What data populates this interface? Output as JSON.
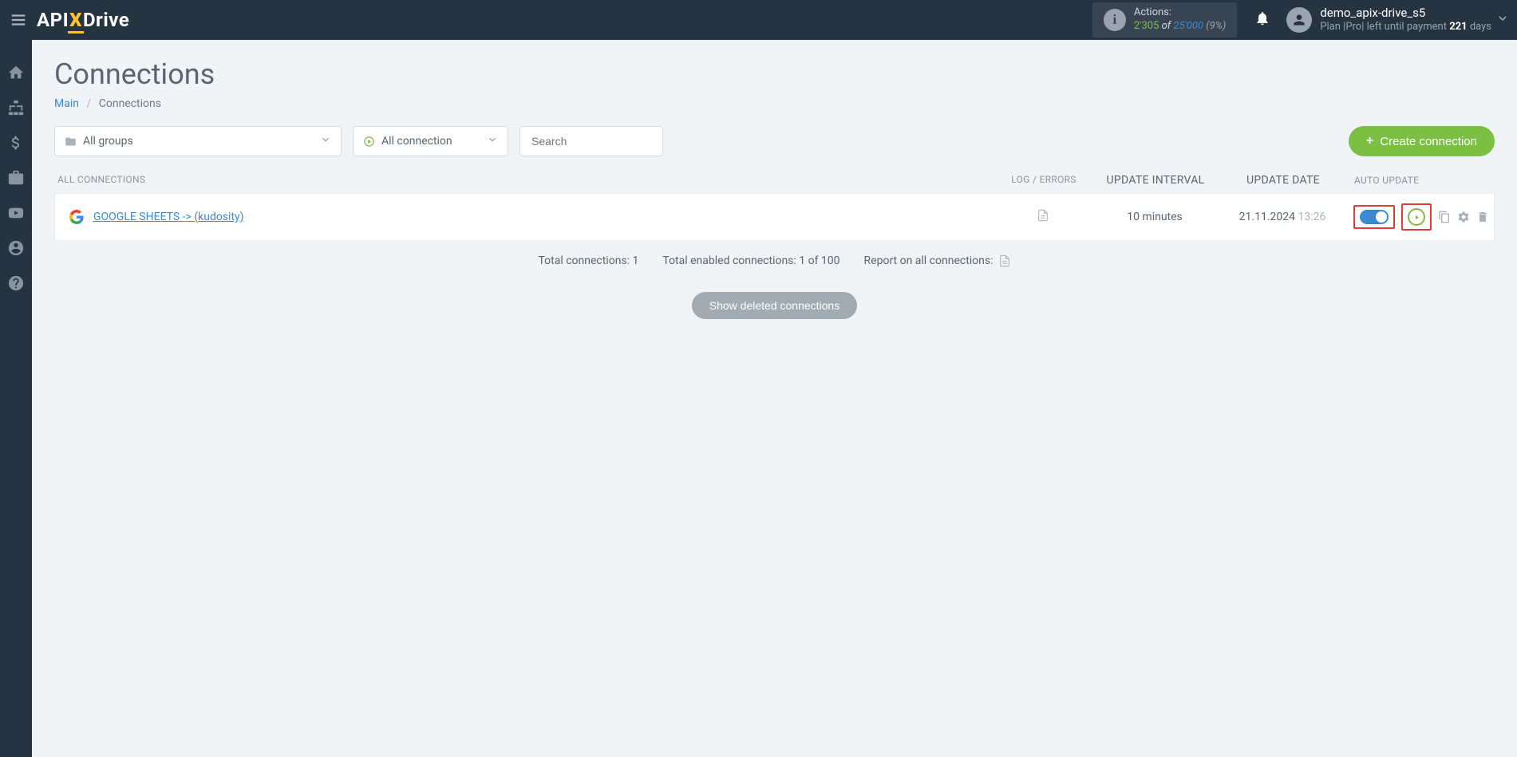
{
  "header": {
    "logo": {
      "api": "API",
      "x": "X",
      "drive": "Drive"
    },
    "actions": {
      "label": "Actions:",
      "used": "2'305",
      "of": "of",
      "total": "25'000",
      "pct": "(9%)"
    },
    "user": {
      "name": "demo_apix-drive_s5",
      "plan_prefix": "Plan |Pro| left until payment ",
      "days": "221",
      "days_suffix": " days"
    }
  },
  "sidebar": {
    "items": [
      "home",
      "sitemap",
      "dollar",
      "briefcase",
      "youtube",
      "user",
      "help"
    ]
  },
  "page": {
    "title": "Connections",
    "breadcrumb_main": "Main",
    "breadcrumb_current": "Connections"
  },
  "toolbar": {
    "groups_label": "All groups",
    "conn_label": "All connection",
    "search_placeholder": "Search",
    "create_label": "Create connection"
  },
  "table": {
    "headers": {
      "name": "ALL CONNECTIONS",
      "log": "LOG / ERRORS",
      "interval": "UPDATE INTERVAL",
      "date": "UPDATE DATE",
      "auto": "AUTO UPDATE"
    },
    "rows": [
      {
        "name": "GOOGLE SHEETS -> (kudosity)",
        "interval": "10 minutes",
        "date": "21.11.2024",
        "time": "13:26",
        "auto_on": true
      }
    ]
  },
  "totals": {
    "total": "Total connections: 1",
    "enabled": "Total enabled connections: 1 of 100",
    "report": "Report on all connections:"
  },
  "show_deleted": "Show deleted connections"
}
